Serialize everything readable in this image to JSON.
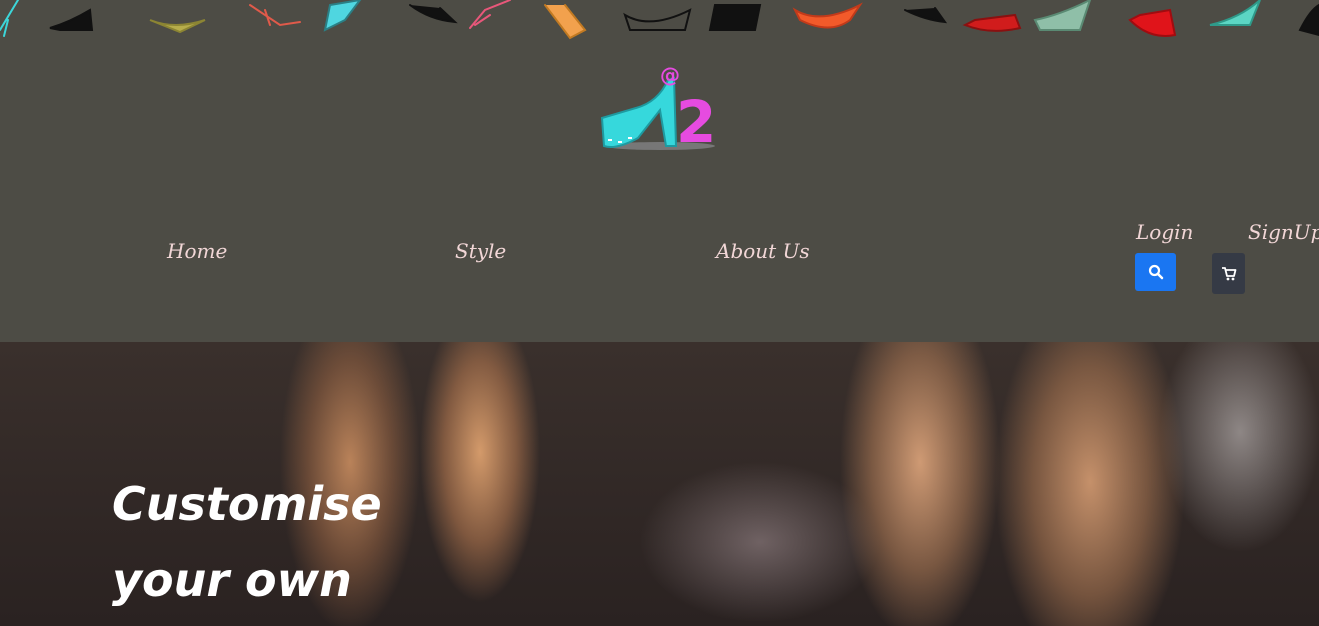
{
  "header": {
    "logo_label": "@ 2",
    "logo_icon": "high-heel-logo-icon",
    "shoe_border_icon": "high-heel-shoe-icon"
  },
  "nav": {
    "home": "Home",
    "style": "Style",
    "about": "About Us",
    "login": "Login",
    "signup": "SignUp"
  },
  "actions": {
    "search_icon": "search-icon",
    "cart_icon": "cart-icon"
  },
  "hero": {
    "line1": "Customise",
    "line2": "your own"
  },
  "colors": {
    "header_bg": "#4d4c45",
    "nav_text": "#f1d6d6",
    "search_btn": "#1a76f2",
    "cart_btn": "#353a45"
  }
}
